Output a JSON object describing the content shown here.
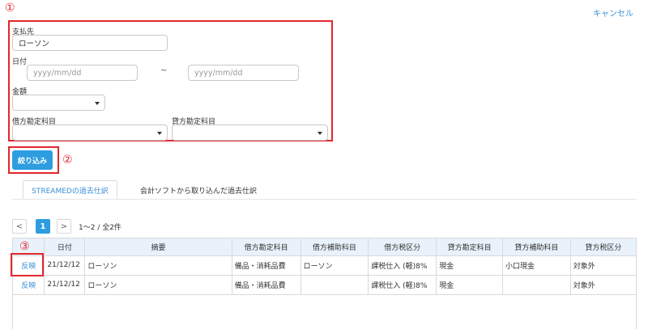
{
  "header": {
    "cancel_label": "キャンセル"
  },
  "annotations": {
    "a1": "①",
    "a2": "②",
    "a3": "③"
  },
  "filters": {
    "payee_label": "支払先",
    "payee_value": "ローソン",
    "date_label": "日付",
    "date_from_placeholder": "yyyy/mm/dd",
    "date_to_placeholder": "yyyy/mm/dd",
    "date_separator": "~",
    "amount_label": "金額",
    "debit_account_label": "借方勘定科目",
    "credit_account_label": "貸方勘定科目",
    "submit_label": "絞り込み"
  },
  "tabs": [
    {
      "label": "STREAMEDの過去仕訳",
      "active": true
    },
    {
      "label": "会計ソフトから取り込んだ過去仕訳",
      "active": false
    }
  ],
  "pagination": {
    "prev": "<",
    "current": "1",
    "next": ">",
    "info": "1～2 / 全2件"
  },
  "table": {
    "headers": [
      "",
      "日付",
      "摘要",
      "借方勘定科目",
      "借方補助科目",
      "借方税区分",
      "貸方勘定科目",
      "貸方補助科目",
      "貸方税区分"
    ],
    "rows": [
      [
        "反映",
        "21/12/12",
        "ローソン",
        "備品・消耗品費",
        "ローソン",
        "課税仕入 (軽)8%",
        "現金",
        "小口現金",
        "対象外"
      ],
      [
        "反映",
        "21/12/12",
        "ローソン",
        "備品・消耗品費",
        "",
        "課税仕入 (軽)8%",
        "現金",
        "",
        "対象外"
      ]
    ]
  },
  "colors": {
    "accent": "#2d9de0",
    "link": "#3a8fd6",
    "annotation_red": "#e3262d",
    "header_bg": "#e9f2fb"
  }
}
